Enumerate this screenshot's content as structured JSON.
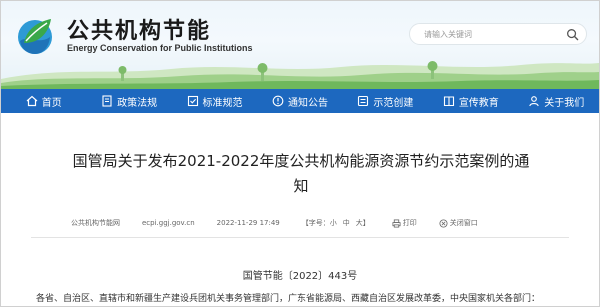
{
  "header": {
    "site_title": "公共机构节能",
    "site_subtitle": "Energy Conservation for Public Institutions",
    "search_placeholder": "请输入关键词",
    "logo_icon": "leaf-globe-logo",
    "search_icon": "search-icon"
  },
  "nav": {
    "items": [
      {
        "label": "首页",
        "icon": "home-icon"
      },
      {
        "label": "政策法规",
        "icon": "policy-icon"
      },
      {
        "label": "标准规范",
        "icon": "standard-icon"
      },
      {
        "label": "通知公告",
        "icon": "notice-icon"
      },
      {
        "label": "示范创建",
        "icon": "demo-icon"
      },
      {
        "label": "宣传教育",
        "icon": "education-icon"
      },
      {
        "label": "关于我们",
        "icon": "about-icon"
      }
    ],
    "color": "#1d68bf"
  },
  "article": {
    "title_line1": "国管局关于发布2021-2022年度公共机构能源资源节约示范案例的通",
    "title_line2": "知",
    "source": "公共机构节能网",
    "url": "ecpi.ggj.gov.cn",
    "datetime": "2022-11-29 17:49",
    "font_size_label": "【字号：",
    "font_small": "小",
    "font_medium": "中",
    "font_large": "大",
    "font_size_end": "】",
    "print_label": "打印",
    "close_label": "关闭窗口",
    "doc_number": "国管节能〔2022〕443号",
    "body_start": "各省、自治区、直辖市和新疆生产建设兵团机关事务管理部门，广东省能源局、西藏自治区发展改革委，中央国家机关各部门："
  }
}
